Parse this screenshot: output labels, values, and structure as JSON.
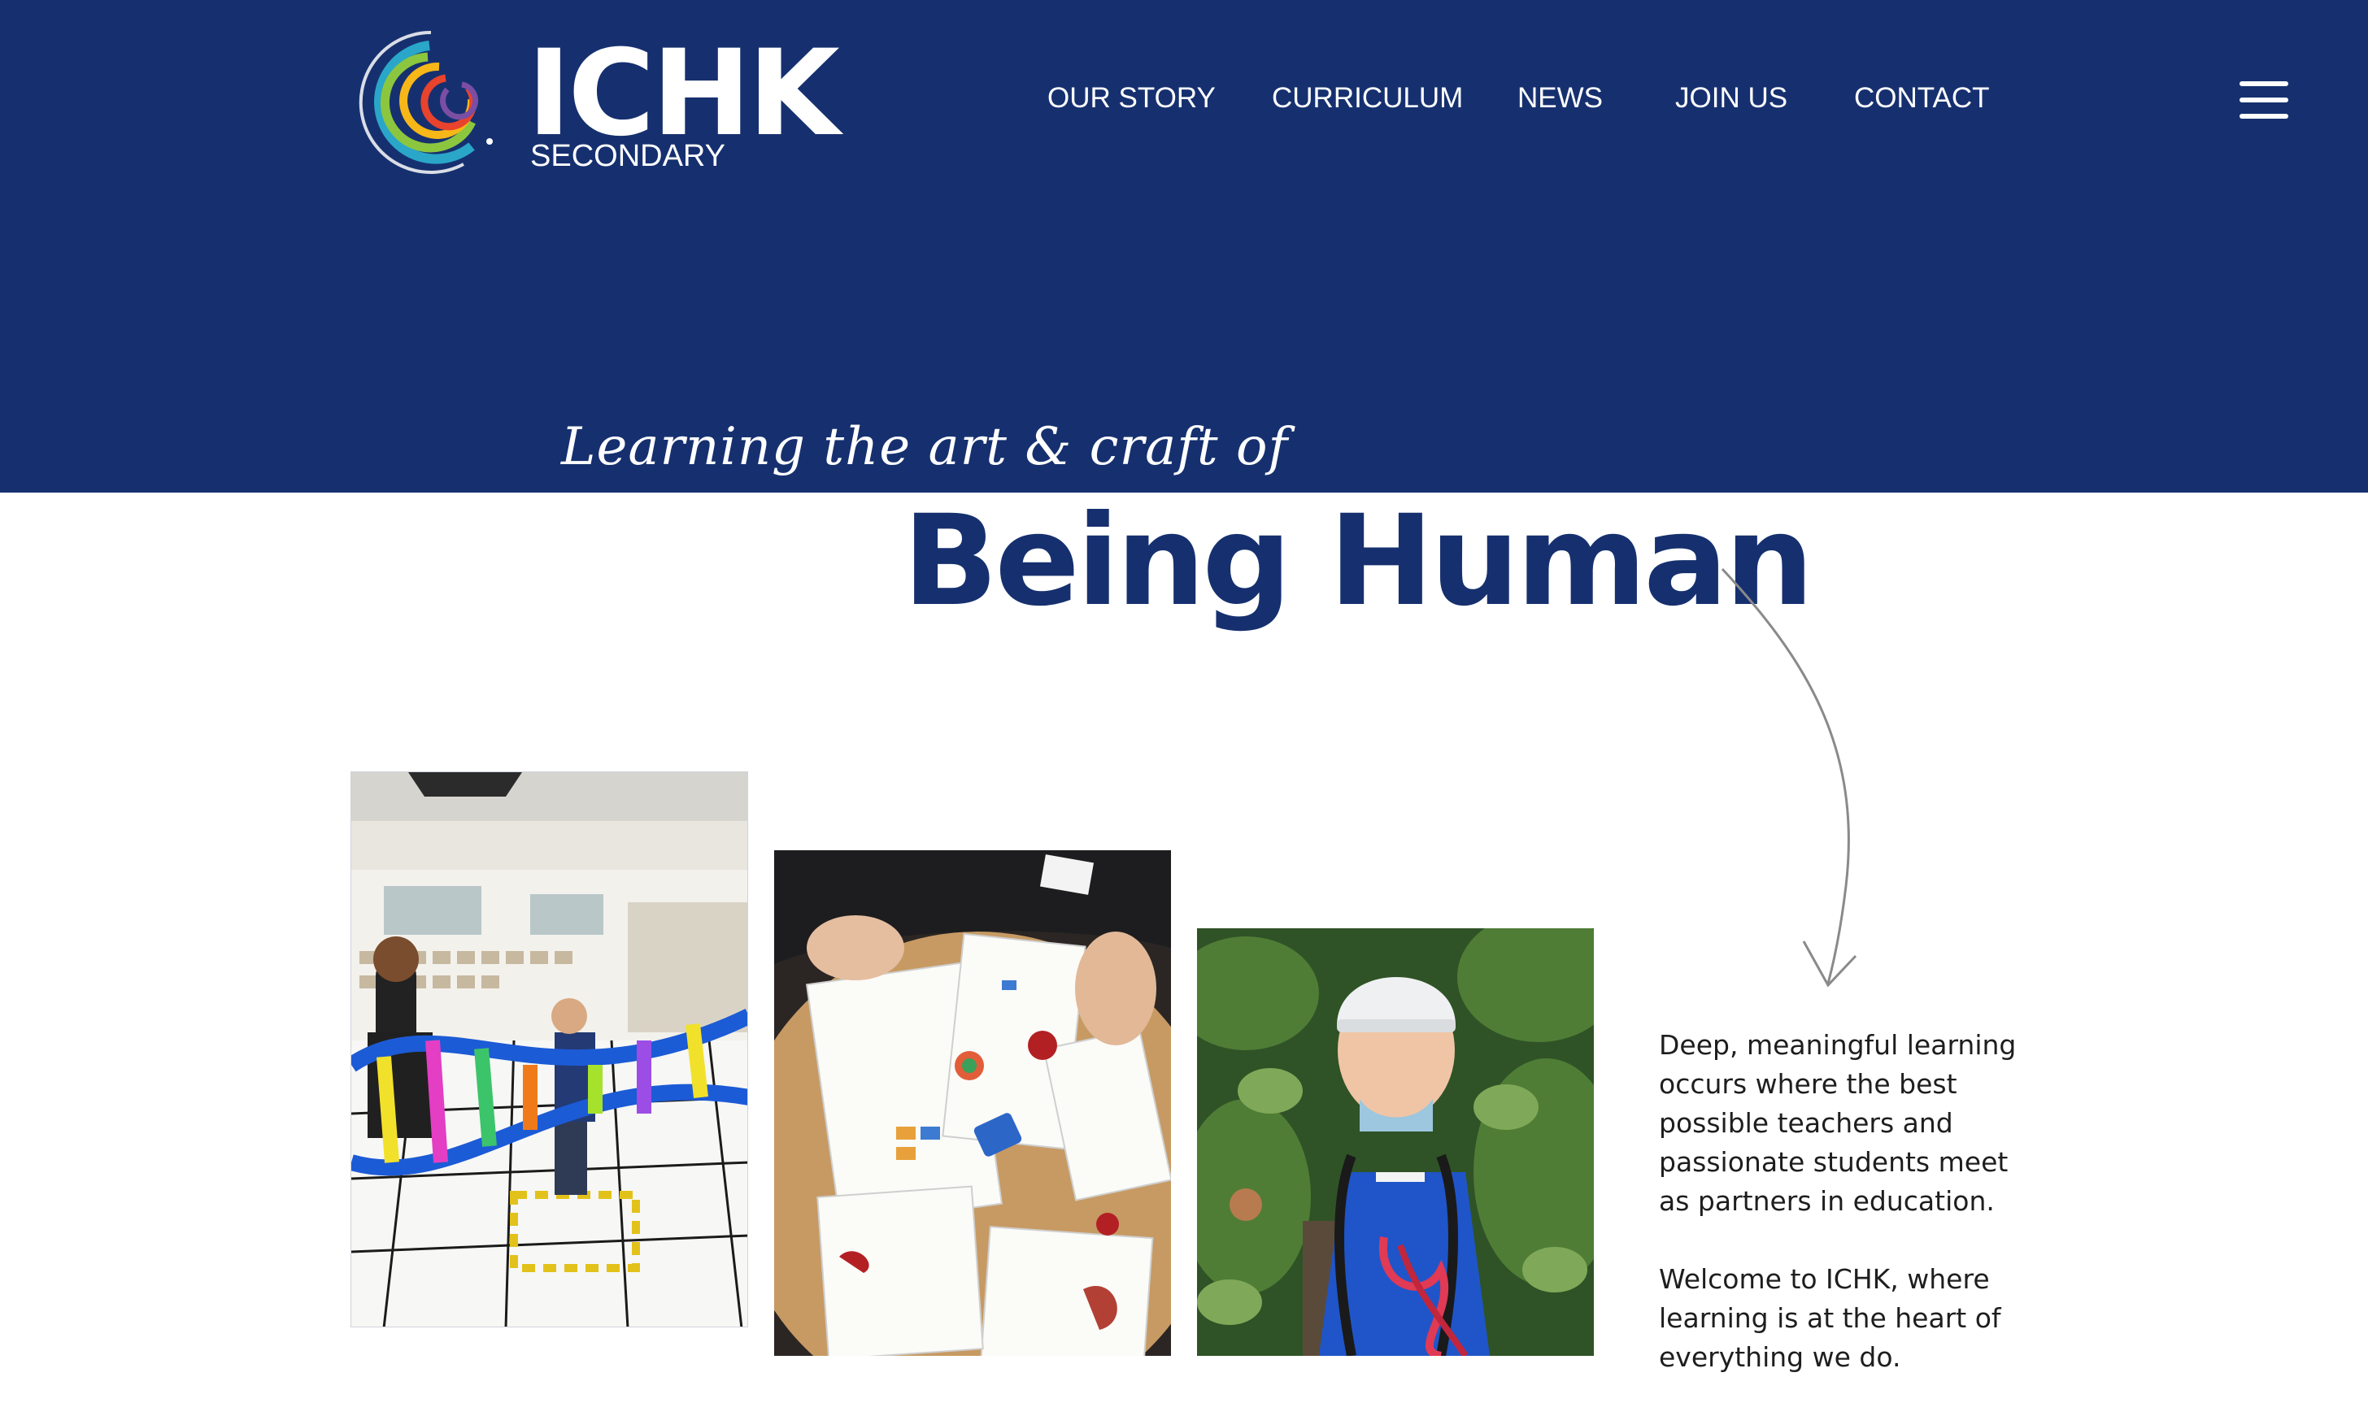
{
  "header": {
    "logo_text": "ICHK",
    "logo_subtext": "SECONDARY",
    "nav": [
      {
        "label": "OUR STORY"
      },
      {
        "label": "CURRICULUM"
      },
      {
        "label": "NEWS"
      },
      {
        "label": "JOIN US"
      },
      {
        "label": "CONTACT"
      }
    ],
    "menu_icon": "hamburger-menu-icon"
  },
  "hero": {
    "tagline": "Learning the art & craft of",
    "headline": "Being Human",
    "arrow_icon": "curved-arrow-icon"
  },
  "gallery": [
    {
      "name": "students-dna-model-photo"
    },
    {
      "name": "students-worksheet-table-photo"
    },
    {
      "name": "student-climbing-helmet-photo"
    }
  ],
  "intro": {
    "paragraph_1": "Deep, meaningful learning occurs where the best possible teachers and passionate students meet as partners in education.",
    "paragraph_2": "Welcome to ICHK, where learning is at the heart of everything we do."
  },
  "colors": {
    "brand_navy": "#16306f",
    "text_dark": "#1e1e1e",
    "background": "#ffffff"
  }
}
